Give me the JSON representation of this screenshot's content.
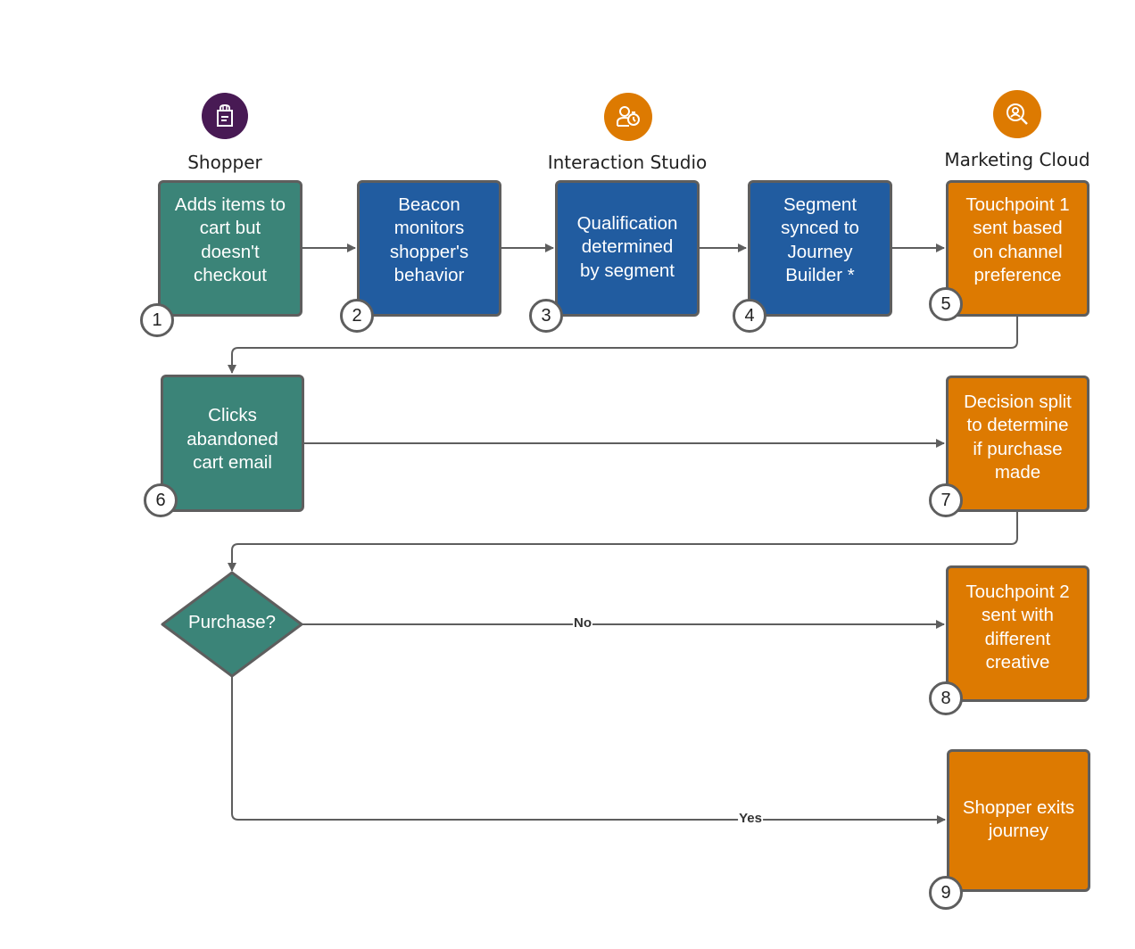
{
  "colors": {
    "shopper": "#3b8478",
    "interaction_studio": "#215ca0",
    "marketing_cloud": "#dd7a01",
    "shopper_icon_bg": "#481a54",
    "connector": "#5e5e5e"
  },
  "lanes": [
    {
      "id": "shopper",
      "label": "Shopper",
      "icon": "shopping-bag-icon"
    },
    {
      "id": "interaction_studio",
      "label": "Interaction Studio",
      "icon": "user-stopwatch-icon"
    },
    {
      "id": "marketing_cloud",
      "label": "Marketing Cloud",
      "icon": "user-search-icon"
    }
  ],
  "steps": [
    {
      "number": "1",
      "text": "Adds items to\ncart but\ndoesn't\ncheckout",
      "lane": "shopper"
    },
    {
      "number": "2",
      "text": "Beacon\nmonitors\nshopper's\nbehavior",
      "lane": "interaction_studio"
    },
    {
      "number": "3",
      "text": "Qualification\ndetermined\nby segment",
      "lane": "interaction_studio"
    },
    {
      "number": "4",
      "text": "Segment\nsynced to\nJourney\nBuilder *",
      "lane": "interaction_studio"
    },
    {
      "number": "5",
      "text": "Touchpoint 1\nsent based\non channel\npreference",
      "lane": "marketing_cloud"
    },
    {
      "number": "6",
      "text": "Clicks\nabandoned\ncart email",
      "lane": "shopper"
    },
    {
      "number": "7",
      "text": "Decision split\nto determine\nif purchase\nmade",
      "lane": "marketing_cloud"
    },
    {
      "number": "8",
      "text": "Touchpoint 2\nsent with\ndifferent\ncreative",
      "lane": "marketing_cloud"
    },
    {
      "number": "9",
      "text": "Shopper exits\njourney",
      "lane": "marketing_cloud"
    }
  ],
  "decision": {
    "text": "Purchase?",
    "lane": "shopper"
  },
  "edges": [
    {
      "from": "1",
      "to": "2",
      "label": ""
    },
    {
      "from": "2",
      "to": "3",
      "label": ""
    },
    {
      "from": "3",
      "to": "4",
      "label": ""
    },
    {
      "from": "4",
      "to": "5",
      "label": ""
    },
    {
      "from": "5",
      "to": "6",
      "label": ""
    },
    {
      "from": "6",
      "to": "7",
      "label": ""
    },
    {
      "from": "7",
      "to": "decision",
      "label": ""
    },
    {
      "from": "decision",
      "to": "8",
      "label": "No"
    },
    {
      "from": "decision",
      "to": "9",
      "label": "Yes"
    }
  ]
}
